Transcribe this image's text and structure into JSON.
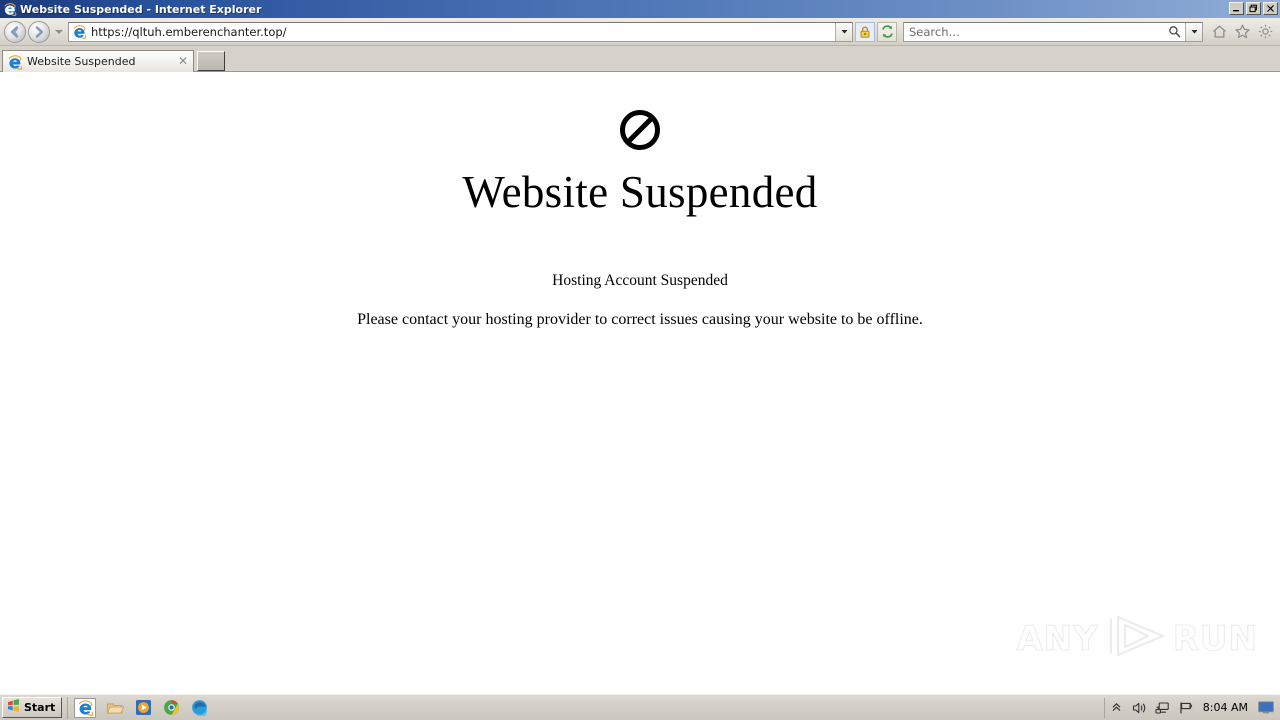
{
  "window": {
    "title": "Website Suspended - Internet Explorer",
    "icon": "ie-logo-icon",
    "minimize_label": "–",
    "maximize_label": "❐",
    "close_label": "✕"
  },
  "toolbar": {
    "back_icon": "back-arrow-icon",
    "forward_icon": "forward-arrow-icon",
    "history_dropdown_icon": "chevron-down-icon",
    "address": {
      "value": "https://qltuh.emberenchanter.top/",
      "site_icon": "ie-logo-icon",
      "dropdown_icon": "chevron-down-icon"
    },
    "security_icon": "lock-icon",
    "refresh_icon": "refresh-icon",
    "search": {
      "placeholder": "Search…",
      "go_icon": "magnifier-icon",
      "dropdown_icon": "chevron-down-icon"
    },
    "home_icon": "home-icon",
    "favorites_icon": "star-icon",
    "settings_icon": "gear-icon"
  },
  "tabs": {
    "items": [
      {
        "label": "Website Suspended",
        "icon": "ie-logo-icon",
        "close_label": "✕"
      }
    ],
    "new_tab_label": ""
  },
  "page": {
    "status_icon": "prohibited-icon",
    "heading": "Website Suspended",
    "subheading": "Hosting Account Suspended",
    "message": "Please contact your hosting provider to correct issues causing your website to be offline.",
    "watermark": {
      "left_text": "ANY",
      "logo_icon": "play-triangle-icon",
      "right_text": "RUN"
    }
  },
  "taskbar": {
    "start_label": "Start",
    "start_icon": "windows-logo-icon",
    "quick_launch": [
      {
        "name": "internet-explorer",
        "icon": "ie-logo-icon"
      },
      {
        "name": "file-explorer",
        "icon": "folder-icon"
      },
      {
        "name": "media-player",
        "icon": "media-player-icon"
      },
      {
        "name": "google-chrome",
        "icon": "chrome-icon"
      },
      {
        "name": "microsoft-edge",
        "icon": "edge-icon"
      }
    ],
    "tray": {
      "expand_icon": "chevron-up-icon",
      "volume_icon": "speaker-icon",
      "network_icon": "network-icon",
      "flag_icon": "flag-icon",
      "clock": "8:04 AM",
      "show_desktop_icon": "show-desktop-icon"
    }
  },
  "colors": {
    "title_bar_blue": "#3c63a8",
    "chrome_beige": "#d6d2ca",
    "taskbar": "#d4d0c8",
    "page_bg": "#ffffff",
    "text": "#000000",
    "lock_yellow": "#e8c24a",
    "refresh_green": "#3f9e3f"
  }
}
